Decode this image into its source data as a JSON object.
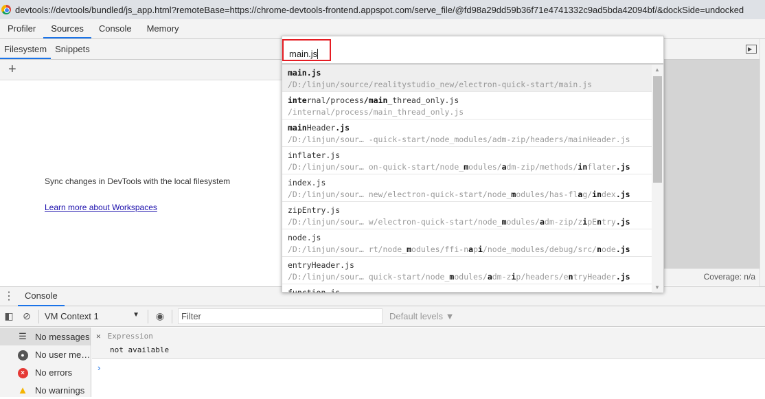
{
  "window": {
    "url": "devtools://devtools/bundled/js_app.html?remoteBase=https://chrome-devtools-frontend.appspot.com/serve_file/@fd98a29dd59b36f71e4741332c9ad5bda42094bf/&dockSide=undocked"
  },
  "main_tabs": [
    {
      "label": "Profiler"
    },
    {
      "label": "Sources"
    },
    {
      "label": "Console"
    },
    {
      "label": "Memory"
    }
  ],
  "active_main_tab": "Sources",
  "navigator": {
    "tabs": [
      {
        "label": "Filesystem"
      },
      {
        "label": "Snippets"
      }
    ],
    "add_label": "+",
    "sync_text": "Sync changes in DevTools with the local filesystem",
    "learn_more": "Learn more about Workspaces"
  },
  "footer": {
    "coverage": "Coverage: n/a"
  },
  "quick_open": {
    "query": "main.js",
    "scroll_fraction": 0.0,
    "items": [
      {
        "title": [
          [
            "main.js",
            1
          ]
        ],
        "path": [
          [
            "/D:/linjun/source/realitystudio_new/electron-quick-start/main.js",
            0
          ]
        ],
        "selected": true
      },
      {
        "title": [
          [
            "inte",
            1
          ],
          [
            "rnal/process",
            0
          ],
          [
            "/main",
            1
          ],
          [
            "_thread_only.js",
            0
          ]
        ],
        "path": [
          [
            "/internal/process/main_thread_only.js",
            0
          ]
        ]
      },
      {
        "title": [
          [
            "main",
            1
          ],
          [
            "Header",
            0
          ],
          [
            ".js",
            1
          ]
        ],
        "path": [
          [
            "/D:/linjun/sour… -quick-start/node_modules/adm-zip/headers/mainHeader.js",
            0
          ]
        ]
      },
      {
        "title": [
          [
            "inflater.js",
            0
          ]
        ],
        "path": [
          [
            "/D:/linjun/sour… on-quick-start/node_",
            0
          ],
          [
            "m",
            1
          ],
          [
            "odules/",
            0
          ],
          [
            "a",
            1
          ],
          [
            "dm-zip/methods/",
            0
          ],
          [
            "in",
            1
          ],
          [
            "flater",
            0
          ],
          [
            ".js",
            1
          ]
        ]
      },
      {
        "title": [
          [
            "index.js",
            0
          ]
        ],
        "path": [
          [
            "/D:/linjun/sour… new/electron-quick-start/node_",
            0
          ],
          [
            "m",
            1
          ],
          [
            "odules/has-fl",
            0
          ],
          [
            "a",
            1
          ],
          [
            "g/",
            0
          ],
          [
            "in",
            1
          ],
          [
            "dex",
            0
          ],
          [
            ".js",
            1
          ]
        ]
      },
      {
        "title": [
          [
            "zipEntry.js",
            0
          ]
        ],
        "path": [
          [
            "/D:/linjun/sour… w/electron-quick-start/node_",
            0
          ],
          [
            "m",
            1
          ],
          [
            "odules/",
            0
          ],
          [
            "a",
            1
          ],
          [
            "dm-zip/z",
            0
          ],
          [
            "i",
            1
          ],
          [
            "pE",
            0
          ],
          [
            "n",
            1
          ],
          [
            "try",
            0
          ],
          [
            ".js",
            1
          ]
        ]
      },
      {
        "title": [
          [
            "node.js",
            0
          ]
        ],
        "path": [
          [
            "/D:/linjun/sour… rt/node_",
            0
          ],
          [
            "m",
            1
          ],
          [
            "odules/ffi-n",
            0
          ],
          [
            "a",
            1
          ],
          [
            "p",
            0
          ],
          [
            "i",
            1
          ],
          [
            "/node_modules/debug/src/",
            0
          ],
          [
            "n",
            1
          ],
          [
            "ode",
            0
          ],
          [
            ".js",
            1
          ]
        ]
      },
      {
        "title": [
          [
            "entryHeader.js",
            0
          ]
        ],
        "path": [
          [
            "/D:/linjun/sour… quick-start/node_",
            0
          ],
          [
            "m",
            1
          ],
          [
            "odules/",
            0
          ],
          [
            "a",
            1
          ],
          [
            "dm-z",
            0
          ],
          [
            "i",
            1
          ],
          [
            "p/headers/e",
            0
          ],
          [
            "n",
            1
          ],
          [
            "tryHeader",
            0
          ],
          [
            ".js",
            1
          ]
        ]
      },
      {
        "title": [
          [
            "function.js",
            0
          ]
        ],
        "path": []
      }
    ]
  },
  "drawer": {
    "tab": "Console"
  },
  "console": {
    "context": "VM Context 1",
    "filter_placeholder": "Filter",
    "levels": "Default levels ▼",
    "sidebar": [
      {
        "label": "No messages",
        "icon": "list-icon"
      },
      {
        "label": "No user me…",
        "icon": "user-icon"
      },
      {
        "label": "No errors",
        "icon": "error-icon"
      },
      {
        "label": "No warnings",
        "icon": "warning-icon"
      }
    ],
    "expression": {
      "label": "Expression",
      "value": "not available"
    },
    "prompt": "›"
  }
}
